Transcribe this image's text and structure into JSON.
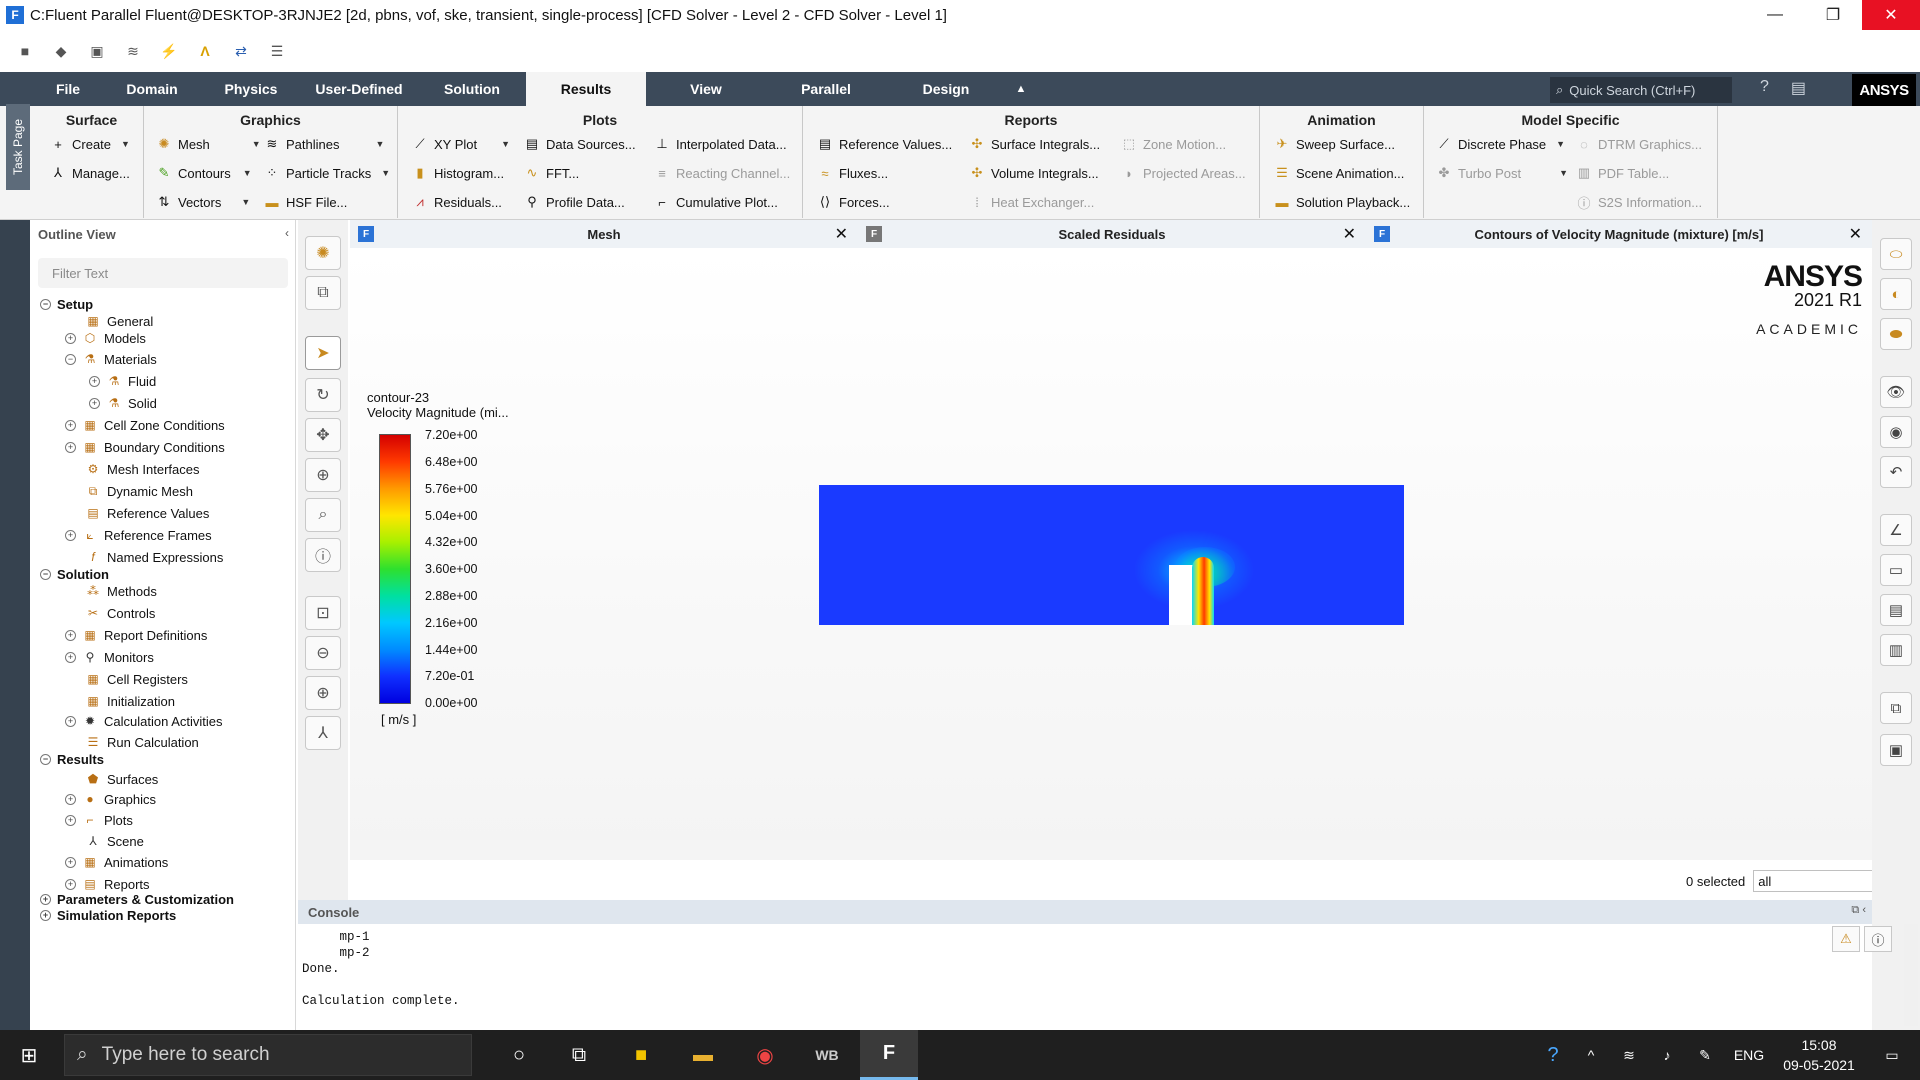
{
  "window": {
    "title": "C:Fluent Parallel Fluent@DESKTOP-3RJNJE2  [2d, pbns, vof, ske, transient, single-process] [CFD Solver - Level 2 - CFD Solver - Level 1]",
    "app_icon": "F",
    "minimize": "—",
    "restore": "❐",
    "close": "✕"
  },
  "menu": {
    "tabs": [
      "File",
      "Domain",
      "Physics",
      "User-Defined",
      "Solution",
      "Results",
      "View",
      "Parallel",
      "Design"
    ],
    "active": "Results",
    "collapse_icon": "▲",
    "quick_search_placeholder": "Quick Search (Ctrl+F)",
    "logo": "ANSYS"
  },
  "ribbon": {
    "task_page": "Task Page",
    "surface": {
      "title": "Surface",
      "create": "Create",
      "manage": "Manage..."
    },
    "graphics": {
      "title": "Graphics",
      "mesh": "Mesh",
      "contours": "Contours",
      "vectors": "Vectors",
      "pathlines": "Pathlines",
      "particle_tracks": "Particle Tracks",
      "hsf_file": "HSF File..."
    },
    "plots": {
      "title": "Plots",
      "xy_plot": "XY Plot",
      "histogram": "Histogram...",
      "residuals": "Residuals...",
      "data_sources": "Data Sources...",
      "fft": "FFT...",
      "profile_data": "Profile Data...",
      "interpolated_data": "Interpolated Data...",
      "reacting_channel": "Reacting Channel...",
      "cumulative_plot": "Cumulative Plot..."
    },
    "reports": {
      "title": "Reports",
      "reference_values": "Reference Values...",
      "fluxes": "Fluxes...",
      "forces": "Forces...",
      "surface_integrals": "Surface Integrals...",
      "volume_integrals": "Volume Integrals...",
      "heat_exchanger": "Heat Exchanger...",
      "zone_motion": "Zone Motion...",
      "projected_areas": "Projected Areas..."
    },
    "animation": {
      "title": "Animation",
      "sweep_surface": "Sweep Surface...",
      "scene_animation": "Scene Animation...",
      "solution_playback": "Solution Playback..."
    },
    "model_specific": {
      "title": "Model Specific",
      "discrete_phase": "Discrete Phase",
      "turbo_post": "Turbo Post",
      "dtrm_graphics": "DTRM Graphics...",
      "pdf_table": "PDF Table...",
      "s2s_information": "S2S Information..."
    }
  },
  "outline": {
    "title": "Outline View",
    "filter_placeholder": "Filter Text",
    "setup": "Setup",
    "general": "General",
    "models": "Models",
    "materials": "Materials",
    "fluid": "Fluid",
    "solid": "Solid",
    "cell_zone_conditions": "Cell Zone Conditions",
    "boundary_conditions": "Boundary Conditions",
    "mesh_interfaces": "Mesh Interfaces",
    "dynamic_mesh": "Dynamic Mesh",
    "reference_values": "Reference Values",
    "reference_frames": "Reference Frames",
    "named_expressions": "Named Expressions",
    "solution": "Solution",
    "methods": "Methods",
    "controls": "Controls",
    "report_definitions": "Report Definitions",
    "monitors": "Monitors",
    "cell_registers": "Cell Registers",
    "initialization": "Initialization",
    "calculation_activities": "Calculation Activities",
    "run_calculation": "Run Calculation",
    "results": "Results",
    "surfaces": "Surfaces",
    "graphics": "Graphics",
    "plots": "Plots",
    "scene": "Scene",
    "animations": "Animations",
    "reports": "Reports",
    "parameters": "Parameters & Customization",
    "simulation_reports": "Simulation Reports"
  },
  "graphics_tabs": [
    {
      "name": "Mesh"
    },
    {
      "name": "Scaled Residuals"
    },
    {
      "name": "Contours of Velocity Magnitude (mixture)  [m/s]"
    }
  ],
  "brand": {
    "name": "ANSYS",
    "version": "2021 R1",
    "edition": "ACADEMIC"
  },
  "legend": {
    "name": "contour-23",
    "variable": "Velocity Magnitude (mi...",
    "ticks": [
      "7.20e+00",
      "6.48e+00",
      "5.76e+00",
      "5.04e+00",
      "4.32e+00",
      "3.60e+00",
      "2.88e+00",
      "2.16e+00",
      "1.44e+00",
      "7.20e-01",
      "0.00e+00"
    ],
    "units": "[ m/s ]"
  },
  "selection": {
    "count_text": "0 selected",
    "filter_value": "all"
  },
  "console": {
    "title": "Console",
    "lines": [
      "     mp-1",
      "     mp-2",
      "Done.",
      "",
      "Calculation complete."
    ]
  },
  "taskbar": {
    "search_placeholder": "Type here to search",
    "language": "ENG",
    "time": "15:08",
    "date": "09-05-2021"
  }
}
